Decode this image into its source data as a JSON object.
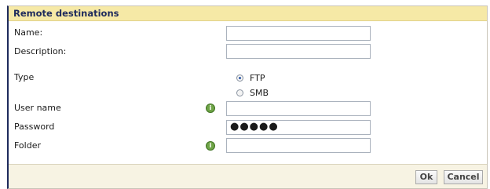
{
  "dialog": {
    "title": "Remote destinations"
  },
  "form": {
    "name_label": "Name:",
    "description_label": "Description:",
    "type_label": "Type",
    "type_options": [
      "FTP",
      "SMB"
    ],
    "selected_type": "FTP",
    "username_label": "User name",
    "password_label": "Password",
    "password_value": "●●●●●",
    "folder_label": "Folder"
  },
  "footer": {
    "ok_label": "Ok",
    "cancel_label": "Cancel"
  },
  "colors": {
    "title_bg": "#f6e9a6",
    "title_text": "#1d2a5c",
    "info_icon": "#6fa447"
  },
  "icons": {
    "info": "info-icon"
  }
}
